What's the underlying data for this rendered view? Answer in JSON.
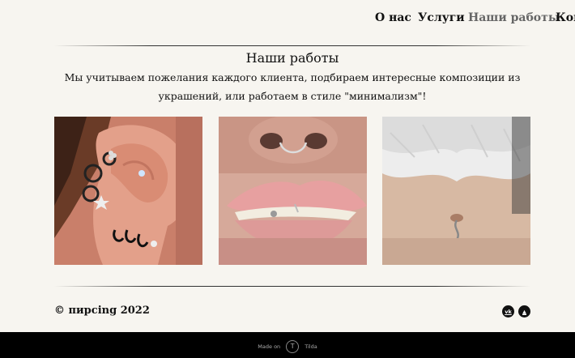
{
  "nav": {
    "items": [
      {
        "label": "О нас"
      },
      {
        "label": "Услуги"
      },
      {
        "label": "Наши работы"
      },
      {
        "label": "Кон"
      }
    ]
  },
  "section": {
    "title": "Наши работы",
    "description": "Мы учитываем пожелания каждого клиента, подбираем интересные композиции из украшений, или работаем в стиле \"минимализм\"!"
  },
  "gallery": [
    {
      "alt": "ear-piercings-photo"
    },
    {
      "alt": "lip-septum-piercing-photo"
    },
    {
      "alt": "navel-piercing-photo"
    }
  ],
  "footer": {
    "copyright": "© пирсing 2022",
    "social": [
      {
        "icon": "vk-icon",
        "text": "vk"
      },
      {
        "icon": "telegram-icon",
        "text": "▲"
      }
    ],
    "made_on": "Made on",
    "tilda": "Tilda",
    "tilda_letter": "T"
  }
}
